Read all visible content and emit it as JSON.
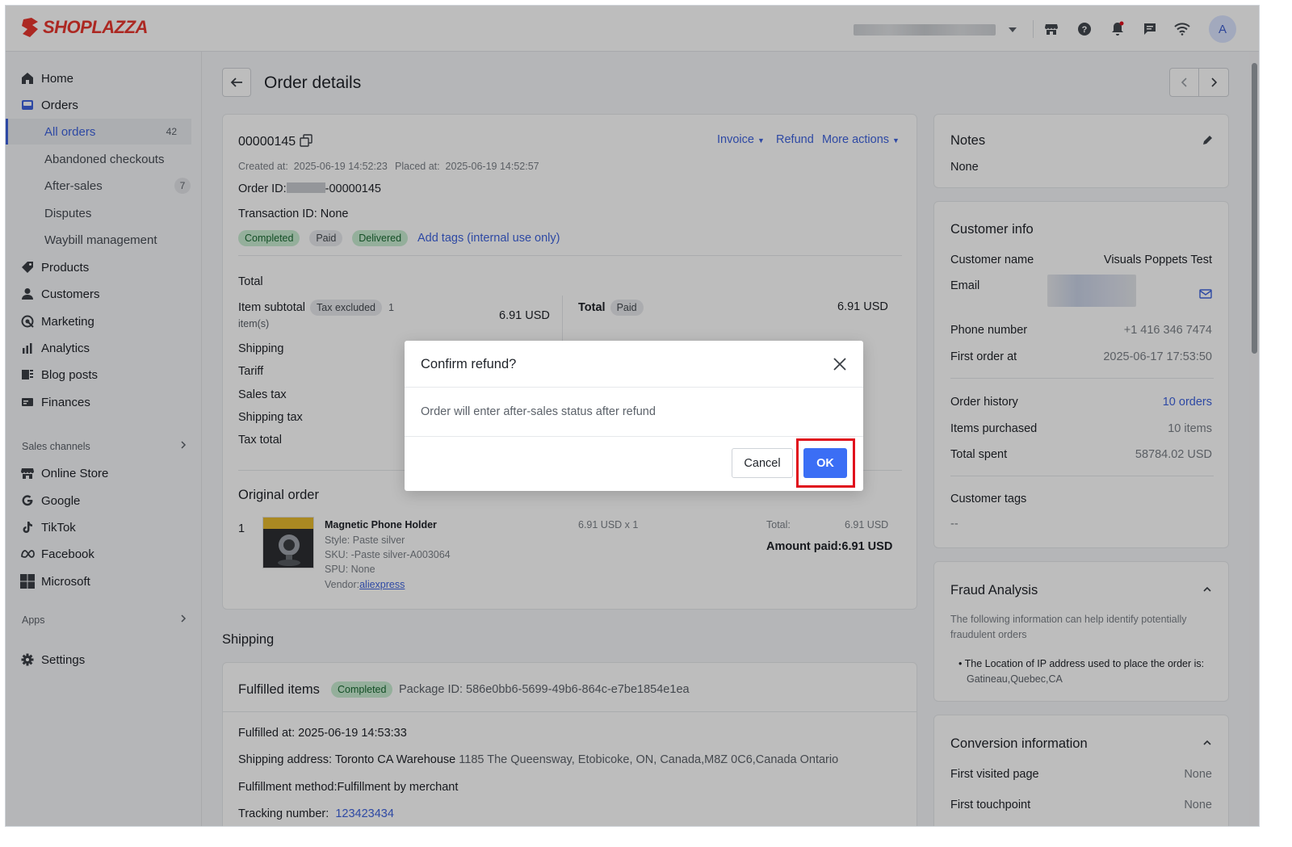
{
  "app": {
    "logo_text": "SHOPLAZZA",
    "avatar_initial": "A"
  },
  "sidebar": {
    "items": [
      {
        "label": "Home",
        "icon": "home-icon"
      },
      {
        "label": "Orders",
        "icon": "orders-icon"
      },
      {
        "label": "All orders",
        "count": "42",
        "active": true
      },
      {
        "label": "Abandoned checkouts"
      },
      {
        "label": "After-sales",
        "count": "7"
      },
      {
        "label": "Disputes"
      },
      {
        "label": "Waybill management"
      },
      {
        "label": "Products",
        "icon": "tag-icon"
      },
      {
        "label": "Customers",
        "icon": "person-icon"
      },
      {
        "label": "Marketing",
        "icon": "marketing-icon"
      },
      {
        "label": "Analytics",
        "icon": "bar-chart-icon"
      },
      {
        "label": "Blog posts",
        "icon": "blog-icon"
      },
      {
        "label": "Finances",
        "icon": "finance-icon"
      }
    ],
    "sales_channels_label": "Sales channels",
    "channels": [
      {
        "label": "Online Store",
        "icon": "store-icon"
      },
      {
        "label": "Google",
        "icon": "google-icon"
      },
      {
        "label": "TikTok",
        "icon": "tiktok-icon"
      },
      {
        "label": "Facebook",
        "icon": "meta-icon"
      },
      {
        "label": "Microsoft",
        "icon": "microsoft-icon"
      }
    ],
    "apps_label": "Apps",
    "settings_label": "Settings"
  },
  "header": {
    "title": "Order details"
  },
  "order": {
    "number": "00000145",
    "actions": {
      "invoice": "Invoice",
      "refund": "Refund",
      "more": "More actions"
    },
    "created_label": "Created at:",
    "created_at": "2025-06-19 14:52:23",
    "placed_label": "Placed at:",
    "placed_at": "2025-06-19 14:52:57",
    "order_id_label": "Order ID:",
    "order_id_suffix": "-00000145",
    "transaction_id": "Transaction ID: None",
    "tags": [
      "Completed",
      "Paid",
      "Delivered"
    ],
    "add_tags": "Add tags (internal use only)",
    "total_heading": "Total",
    "item_subtotal_label": "Item subtotal",
    "tax_excluded": "Tax excluded",
    "item_count_1": "1",
    "item_count_2": "item(s)",
    "item_subtotal_value": "6.91 USD",
    "right_total_label": "Total",
    "right_paid_tag": "Paid",
    "right_total_value": "6.91 USD",
    "summary_rows": [
      "Shipping",
      "Tariff",
      "Sales tax",
      "Shipping tax",
      "Tax total"
    ],
    "original_order_heading": "Original order",
    "line_item": {
      "index": "1",
      "name": "Magnetic Phone Holder",
      "style": "Style: Paste silver",
      "sku": "SKU: -Paste silver-A003064",
      "spu": "SPU: None",
      "vendor_label": "Vendor:",
      "vendor": "aliexpress",
      "qty_price": "6.91 USD x 1",
      "total_label": "Total:",
      "total_value": "6.91 USD",
      "amount_paid": "Amount paid:6.91 USD"
    }
  },
  "shipping": {
    "heading": "Shipping",
    "fulfilled_heading": "Fulfilled items",
    "status": "Completed",
    "package_id": "Package ID: 586e0bb6-5699-49b6-864c-e7be1854e1ea",
    "fulfilled_at": "Fulfilled at:  2025-06-19 14:53:33",
    "address_label": "Shipping address: Toronto CA Warehouse",
    "address_value": "1185 The Queensway, Etobicoke, ON, Canada,M8Z 0C6,Canada Ontario",
    "method": "Fulfillment method:Fulfillment by merchant",
    "tracking_label": "Tracking number:",
    "tracking_value": "123423434"
  },
  "notes": {
    "heading": "Notes",
    "value": "None"
  },
  "customer": {
    "heading": "Customer info",
    "name_label": "Customer name",
    "name_value": "Visuals Poppets Test",
    "email_label": "Email",
    "phone_label": "Phone number",
    "phone_value": "+1 416 346 7474",
    "first_order_label": "First order at",
    "first_order_value": "2025-06-17 17:53:50",
    "history_label": "Order history",
    "history_value": "10 orders",
    "items_label": "Items purchased",
    "items_value": "10 items",
    "spent_label": "Total spent",
    "spent_value": "58784.02 USD",
    "tags_label": "Customer tags",
    "tags_value": "--"
  },
  "fraud": {
    "heading": "Fraud Analysis",
    "description": "The following information can help identify potentially fraudulent orders",
    "bullet_1": "The Location of IP address used to place the order is:",
    "bullet_2": "Gatineau,Quebec,CA"
  },
  "conversion": {
    "heading": "Conversion information",
    "first_page_label": "First visited page",
    "first_page_value": "None",
    "first_touch_label": "First touchpoint",
    "first_touch_value": "None"
  },
  "modal": {
    "title": "Confirm refund?",
    "body": "Order will enter after-sales status after refund",
    "cancel": "Cancel",
    "ok": "OK"
  },
  "colors": {
    "accent": "#3e63dd",
    "ok_button": "#3b6ef5",
    "highlight": "#e0101d",
    "brand": "#e8372e"
  }
}
